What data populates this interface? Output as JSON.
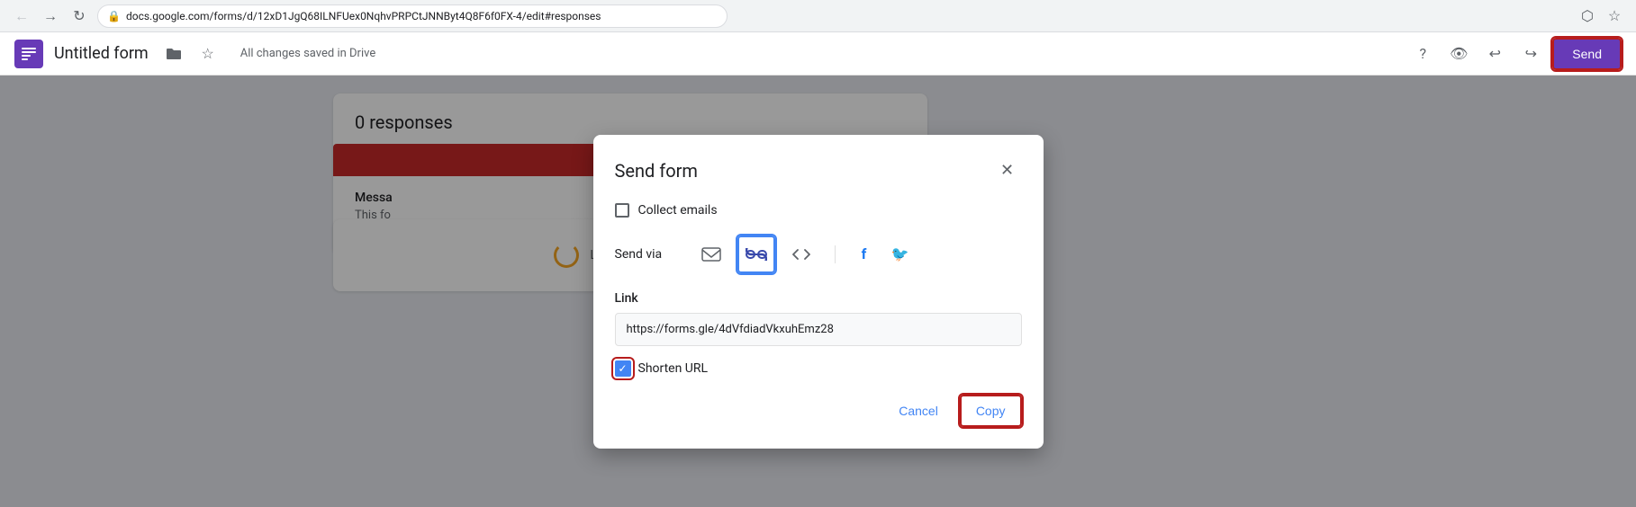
{
  "browser": {
    "url": "docs.google.com/forms/d/12xD1JgQ68ILNFUex0NqhvPRPCtJNNByt4Q8F6f0FX-4/edit#responses",
    "back_disabled": false,
    "forward_disabled": false
  },
  "app_header": {
    "title": "Untitled form",
    "saved_text": "All changes saved in Drive",
    "send_label": "Send"
  },
  "main": {
    "response_count": "0 res",
    "loading_text": "Loading responses..."
  },
  "modal": {
    "title": "Send form",
    "collect_emails_label": "Collect emails",
    "send_via_label": "Send via",
    "link_label": "Link",
    "link_url": "https://forms.gle/4dVfdiadVkxuhEmz28",
    "shorten_url_label": "Shorten URL",
    "shorten_url_checked": true,
    "cancel_label": "Cancel",
    "copy_label": "Copy"
  }
}
